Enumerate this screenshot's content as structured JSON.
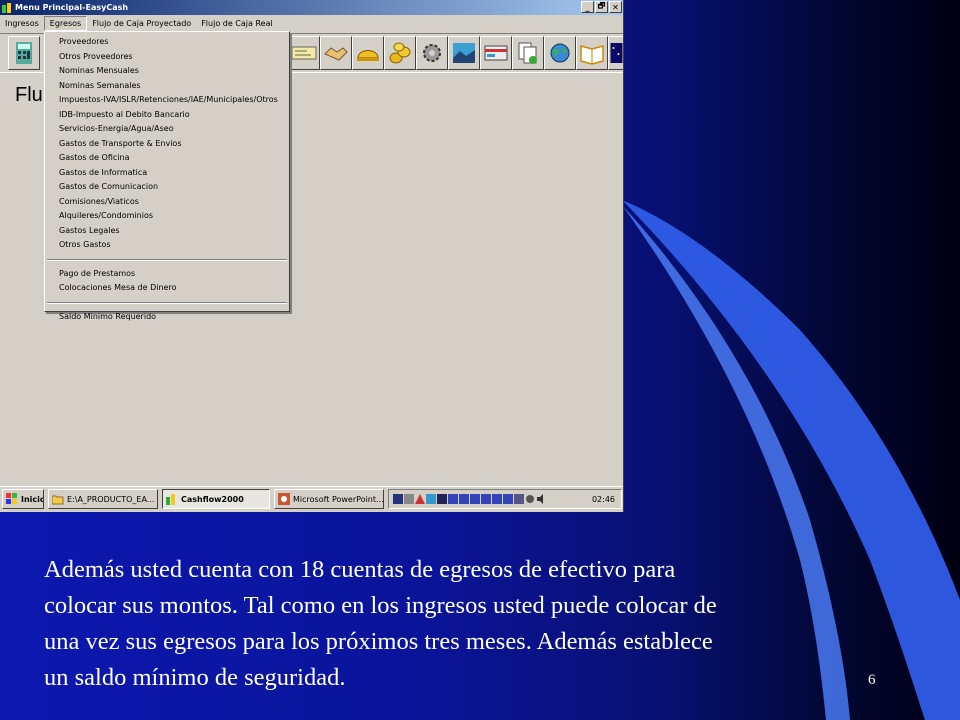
{
  "window": {
    "title": "Menu Principal-EasyCash",
    "buttons": {
      "minimize": "_",
      "restore": "🗗",
      "close": "✕"
    }
  },
  "menubar": [
    "Ingresos",
    "Egresos",
    "Flujo de Caja Proyectado",
    "Flujo de Caja Real"
  ],
  "page_title": "Flu",
  "toolbar_icons": [
    "calculator-icon",
    "printer-icon",
    "folder-icon",
    "check-icon",
    "handshake-icon",
    "helmet-icon",
    "coins-icon",
    "gear-icon",
    "landscape-icon",
    "card-icon",
    "documents-icon",
    "globe-icon",
    "phone-icon",
    "book-icon",
    "night-window-icon"
  ],
  "dropdown": {
    "group1": [
      "Proveedores",
      "Otros Proveedores",
      "Nominas Mensuales",
      "Nominas Semanales",
      "Impuestos-IVA/ISLR/Retenciones/IAE/Municipales/Otros",
      "IDB-Impuesto al Debito Bancario",
      "Servicios-Energia/Agua/Aseo",
      "Gastos de Transporte & Envios",
      "Gastos de Oficina",
      "Gastos de Informatica",
      "Gastos de Comunicacion",
      "Comisiones/Viaticos",
      "Alquileres/Condominios",
      "Gastos Legales",
      "Otros Gastos"
    ],
    "group2": [
      "Pago de Prestamos",
      "Colocaciones Mesa de Dinero"
    ],
    "group3": [
      "Saldo Minimo Requerido"
    ]
  },
  "taskbar": {
    "start": "Inicio",
    "buttons": [
      "E:\\A_PRODUCTO_EA...",
      "Cashflow2000",
      "Microsoft PowerPoint..."
    ],
    "clock": "02:46"
  },
  "slide": {
    "lines": [
      "Además usted cuenta con 18 cuentas de egresos de efectivo para",
      "colocar sus montos. Tal como en los ingresos usted puede colocar de",
      "una vez sus egresos para los próximos tres meses. Además establece",
      "un saldo mínimo  de seguridad."
    ],
    "page_number": "6"
  },
  "colors": {
    "slide_bg": "#0c18b0",
    "swoosh": "#3a6cf0",
    "titlebar": "#0a246a",
    "window_face": "#d4d0c8"
  }
}
